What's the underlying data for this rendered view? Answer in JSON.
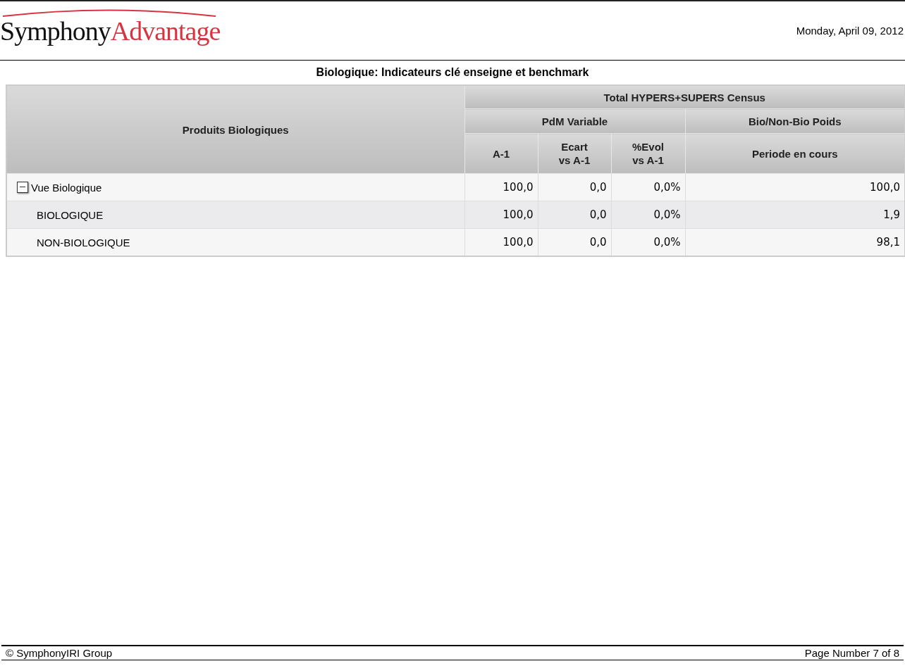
{
  "header": {
    "logo": {
      "part_1": "Symphony",
      "part_2": "Advantage"
    },
    "date": "Monday, April 09, 2012"
  },
  "report_title": "Biologique: Indicateurs clé enseigne et benchmark",
  "table": {
    "row_header": "Produits Biologiques",
    "group_header": "Total HYPERS+SUPERS Census",
    "subgroups": [
      {
        "label": "PdM Variable",
        "columns": [
          "A-1",
          "Ecart\nvs A-1",
          "%Evol\nvs A-1"
        ]
      },
      {
        "label": "Bio/Non-Bio Poids",
        "columns": [
          "Periode en cours"
        ]
      }
    ],
    "rows": [
      {
        "label": "Vue Biologique",
        "expanded": true,
        "values": [
          "100,0",
          "0,0",
          "0,0%",
          "100,0"
        ],
        "children": [
          {
            "label": "BIOLOGIQUE",
            "values": [
              "100,0",
              "0,0",
              "0,0%",
              "1,9"
            ]
          },
          {
            "label": "NON-BIOLOGIQUE",
            "values": [
              "100,0",
              "0,0",
              "0,0%",
              "98,1"
            ]
          }
        ]
      }
    ]
  },
  "footer": {
    "copyright": "© SymphonyIRI Group",
    "page": "Page Number 7 of 8"
  }
}
